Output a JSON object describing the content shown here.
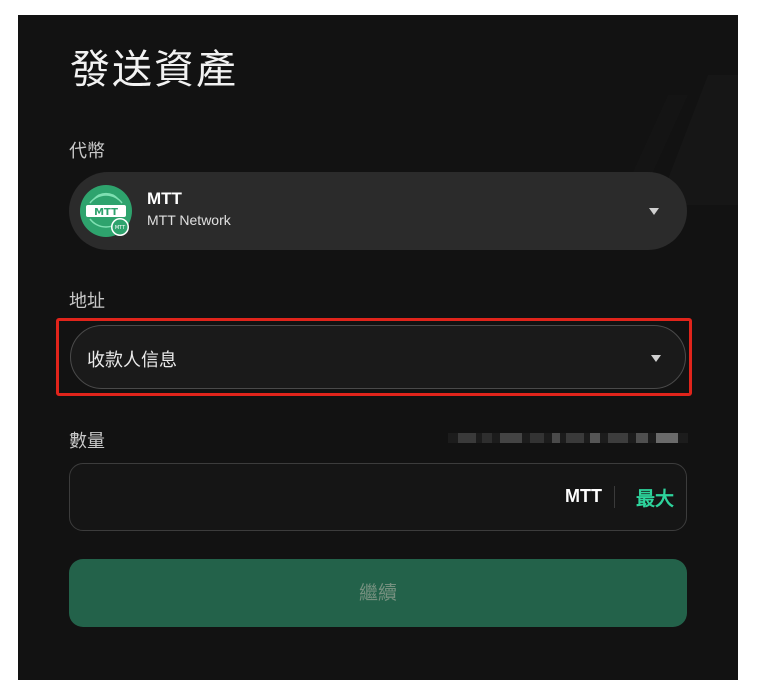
{
  "dialog": {
    "title": "發送資產"
  },
  "token": {
    "label": "代幣",
    "selected_symbol": "MTT",
    "selected_network": "MTT Network",
    "logo_text": "MTT",
    "badge_text": "MTT",
    "logo_color": "#2ea36d",
    "icon": "chevron-down-icon"
  },
  "address": {
    "label": "地址",
    "placeholder": "收款人信息",
    "highlight_color": "#e0241b",
    "icon": "chevron-down-icon"
  },
  "amount": {
    "label": "數量",
    "value": "",
    "unit": "MTT",
    "max_label": "最大"
  },
  "actions": {
    "continue_label": "繼續",
    "continue_color": "#23624a"
  },
  "colors": {
    "background": "#121212",
    "accent": "#2ed39c"
  }
}
